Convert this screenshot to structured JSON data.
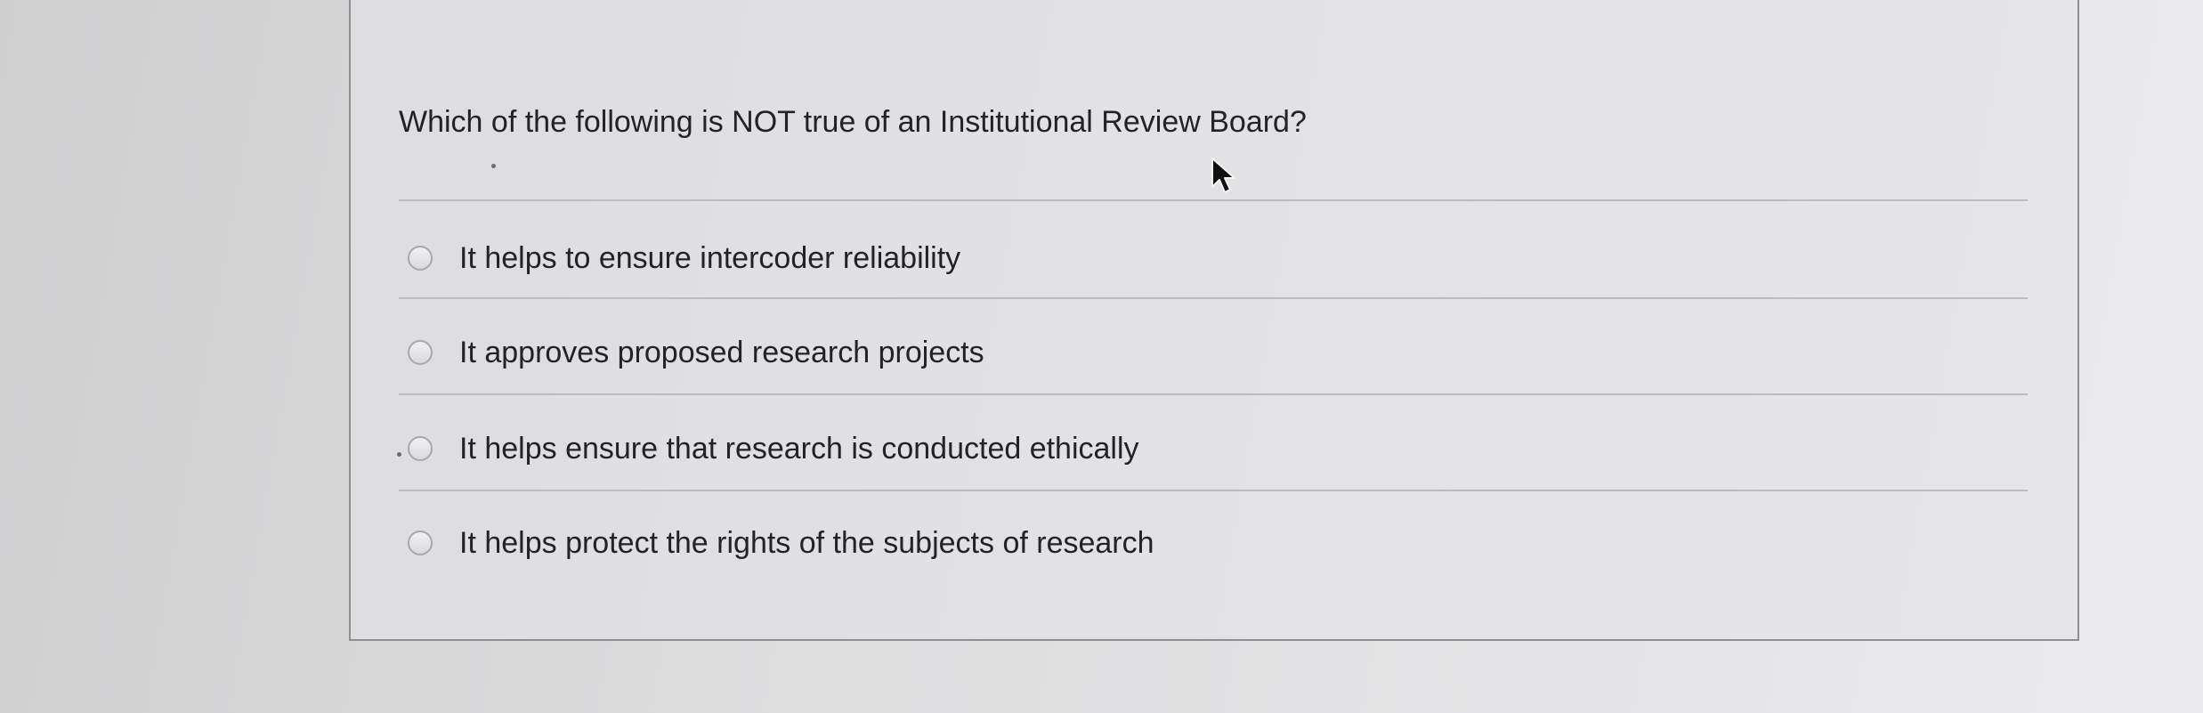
{
  "question": {
    "text": "Which of the following is NOT true of an Institutional Review Board?"
  },
  "options": [
    {
      "label": "It helps to ensure intercoder reliability",
      "selected": false
    },
    {
      "label": "It approves proposed research projects",
      "selected": false
    },
    {
      "label": "It helps ensure that research is conducted ethically",
      "selected": false
    },
    {
      "label": "It helps protect the rights of the subjects of research",
      "selected": false
    }
  ],
  "icons": {
    "cursor": "mouse-pointer-icon",
    "radio": "radio-button-icon"
  }
}
